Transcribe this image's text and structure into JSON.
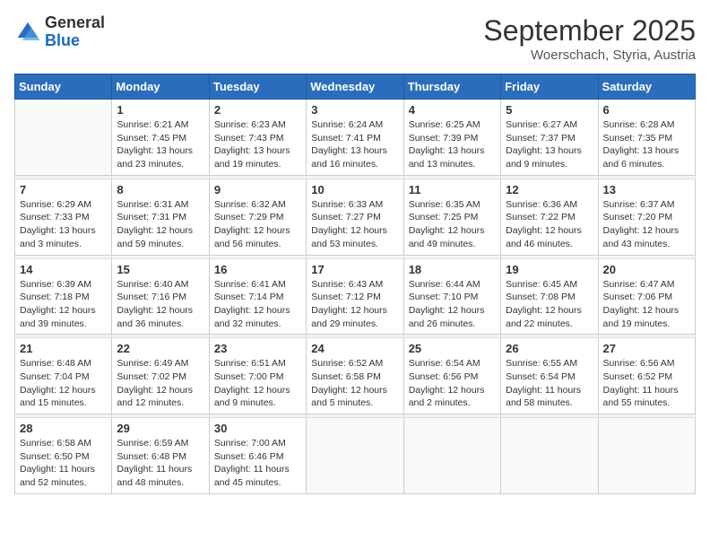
{
  "logo": {
    "general": "General",
    "blue": "Blue"
  },
  "title": "September 2025",
  "location": "Woerschach, Styria, Austria",
  "weekdays": [
    "Sunday",
    "Monday",
    "Tuesday",
    "Wednesday",
    "Thursday",
    "Friday",
    "Saturday"
  ],
  "weeks": [
    [
      {
        "day": "",
        "empty": true
      },
      {
        "day": "1",
        "sunrise": "6:21 AM",
        "sunset": "7:45 PM",
        "daylight": "13 hours and 23 minutes."
      },
      {
        "day": "2",
        "sunrise": "6:23 AM",
        "sunset": "7:43 PM",
        "daylight": "13 hours and 19 minutes."
      },
      {
        "day": "3",
        "sunrise": "6:24 AM",
        "sunset": "7:41 PM",
        "daylight": "13 hours and 16 minutes."
      },
      {
        "day": "4",
        "sunrise": "6:25 AM",
        "sunset": "7:39 PM",
        "daylight": "13 hours and 13 minutes."
      },
      {
        "day": "5",
        "sunrise": "6:27 AM",
        "sunset": "7:37 PM",
        "daylight": "13 hours and 9 minutes."
      },
      {
        "day": "6",
        "sunrise": "6:28 AM",
        "sunset": "7:35 PM",
        "daylight": "13 hours and 6 minutes."
      }
    ],
    [
      {
        "day": "7",
        "sunrise": "6:29 AM",
        "sunset": "7:33 PM",
        "daylight": "13 hours and 3 minutes."
      },
      {
        "day": "8",
        "sunrise": "6:31 AM",
        "sunset": "7:31 PM",
        "daylight": "12 hours and 59 minutes."
      },
      {
        "day": "9",
        "sunrise": "6:32 AM",
        "sunset": "7:29 PM",
        "daylight": "12 hours and 56 minutes."
      },
      {
        "day": "10",
        "sunrise": "6:33 AM",
        "sunset": "7:27 PM",
        "daylight": "12 hours and 53 minutes."
      },
      {
        "day": "11",
        "sunrise": "6:35 AM",
        "sunset": "7:25 PM",
        "daylight": "12 hours and 49 minutes."
      },
      {
        "day": "12",
        "sunrise": "6:36 AM",
        "sunset": "7:22 PM",
        "daylight": "12 hours and 46 minutes."
      },
      {
        "day": "13",
        "sunrise": "6:37 AM",
        "sunset": "7:20 PM",
        "daylight": "12 hours and 43 minutes."
      }
    ],
    [
      {
        "day": "14",
        "sunrise": "6:39 AM",
        "sunset": "7:18 PM",
        "daylight": "12 hours and 39 minutes."
      },
      {
        "day": "15",
        "sunrise": "6:40 AM",
        "sunset": "7:16 PM",
        "daylight": "12 hours and 36 minutes."
      },
      {
        "day": "16",
        "sunrise": "6:41 AM",
        "sunset": "7:14 PM",
        "daylight": "12 hours and 32 minutes."
      },
      {
        "day": "17",
        "sunrise": "6:43 AM",
        "sunset": "7:12 PM",
        "daylight": "12 hours and 29 minutes."
      },
      {
        "day": "18",
        "sunrise": "6:44 AM",
        "sunset": "7:10 PM",
        "daylight": "12 hours and 26 minutes."
      },
      {
        "day": "19",
        "sunrise": "6:45 AM",
        "sunset": "7:08 PM",
        "daylight": "12 hours and 22 minutes."
      },
      {
        "day": "20",
        "sunrise": "6:47 AM",
        "sunset": "7:06 PM",
        "daylight": "12 hours and 19 minutes."
      }
    ],
    [
      {
        "day": "21",
        "sunrise": "6:48 AM",
        "sunset": "7:04 PM",
        "daylight": "12 hours and 15 minutes."
      },
      {
        "day": "22",
        "sunrise": "6:49 AM",
        "sunset": "7:02 PM",
        "daylight": "12 hours and 12 minutes."
      },
      {
        "day": "23",
        "sunrise": "6:51 AM",
        "sunset": "7:00 PM",
        "daylight": "12 hours and 9 minutes."
      },
      {
        "day": "24",
        "sunrise": "6:52 AM",
        "sunset": "6:58 PM",
        "daylight": "12 hours and 5 minutes."
      },
      {
        "day": "25",
        "sunrise": "6:54 AM",
        "sunset": "6:56 PM",
        "daylight": "12 hours and 2 minutes."
      },
      {
        "day": "26",
        "sunrise": "6:55 AM",
        "sunset": "6:54 PM",
        "daylight": "11 hours and 58 minutes."
      },
      {
        "day": "27",
        "sunrise": "6:56 AM",
        "sunset": "6:52 PM",
        "daylight": "11 hours and 55 minutes."
      }
    ],
    [
      {
        "day": "28",
        "sunrise": "6:58 AM",
        "sunset": "6:50 PM",
        "daylight": "11 hours and 52 minutes."
      },
      {
        "day": "29",
        "sunrise": "6:59 AM",
        "sunset": "6:48 PM",
        "daylight": "11 hours and 48 minutes."
      },
      {
        "day": "30",
        "sunrise": "7:00 AM",
        "sunset": "6:46 PM",
        "daylight": "11 hours and 45 minutes."
      },
      {
        "day": "",
        "empty": true
      },
      {
        "day": "",
        "empty": true
      },
      {
        "day": "",
        "empty": true
      },
      {
        "day": "",
        "empty": true
      }
    ]
  ]
}
